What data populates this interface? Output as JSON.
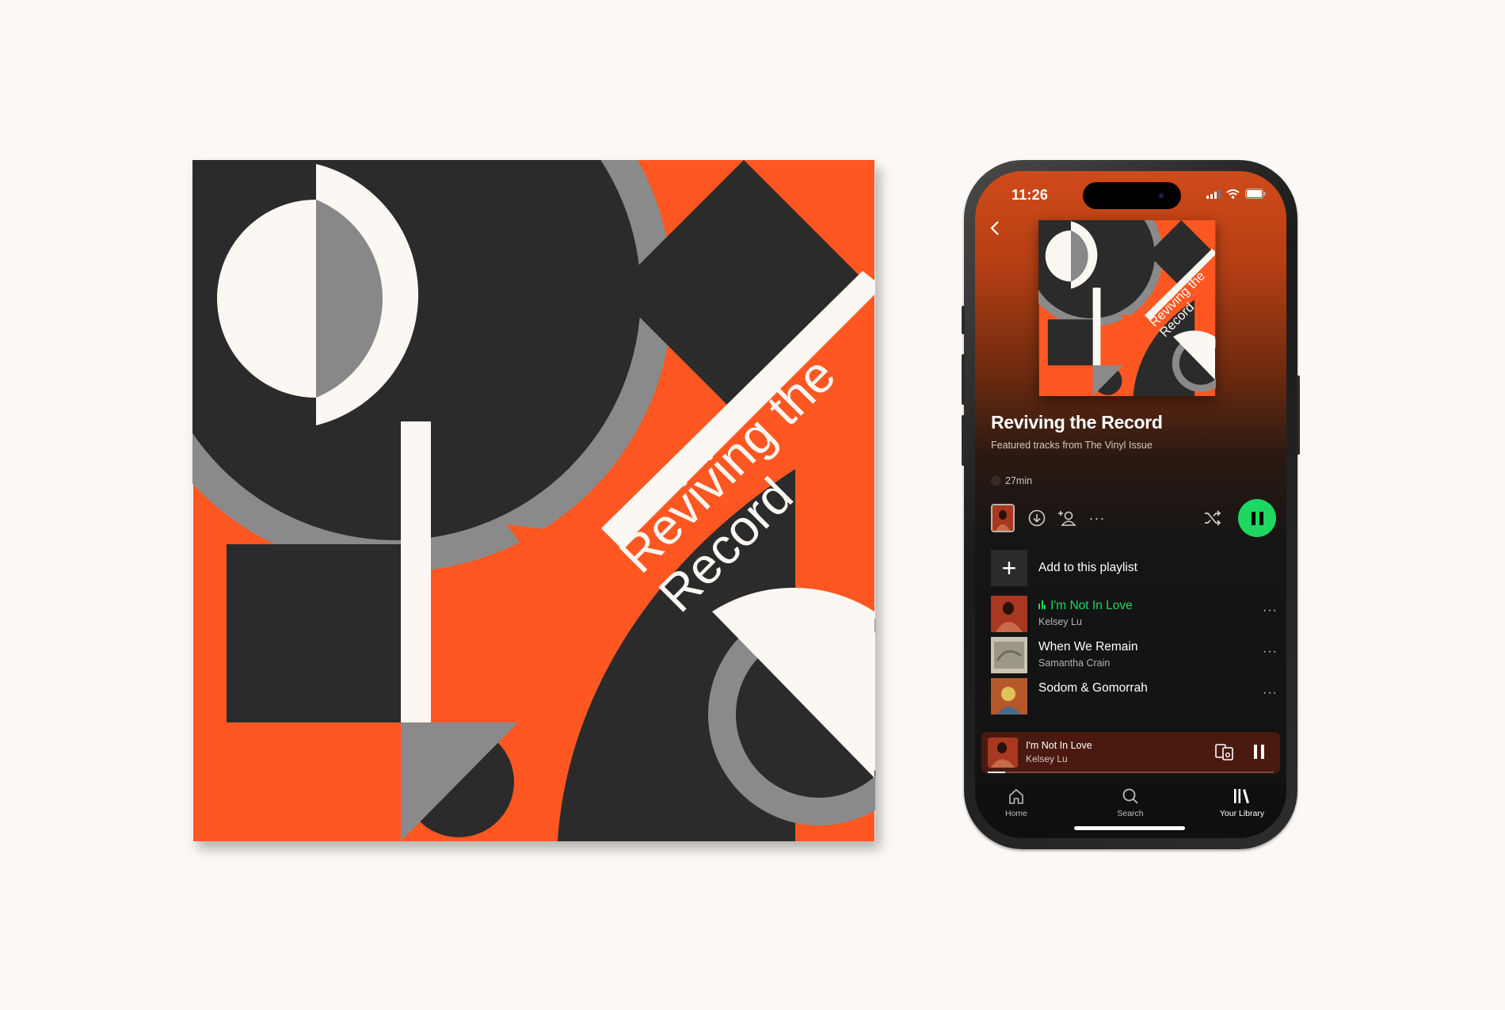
{
  "album_art": {
    "title_line1": "Reviving the",
    "title_line2": "Record"
  },
  "colors": {
    "orange": "#ff5722",
    "charcoal": "#2b2b2b",
    "grey": "#888888",
    "cream": "#fbf7f3",
    "spotify_green": "#1ed760"
  },
  "status_bar": {
    "time": "11:26"
  },
  "playlist": {
    "title": "Reviving the Record",
    "subtitle": "Featured tracks from The Vinyl Issue",
    "duration": "27min",
    "add_label": "Add to this playlist"
  },
  "tracks": [
    {
      "title": "I'm Not In Love",
      "artist": "Kelsey Lu",
      "playing": true
    },
    {
      "title": "When We Remain",
      "artist": "Samantha Crain",
      "playing": false
    },
    {
      "title": "Sodom & Gomorrah",
      "artist": "",
      "playing": false
    }
  ],
  "now_playing": {
    "title": "I'm Not In Love",
    "artist": "Kelsey Lu",
    "progress": 0.06
  },
  "tabs": [
    {
      "label": "Home",
      "icon": "home-icon"
    },
    {
      "label": "Search",
      "icon": "search-icon"
    },
    {
      "label": "Your Library",
      "icon": "library-icon"
    }
  ]
}
